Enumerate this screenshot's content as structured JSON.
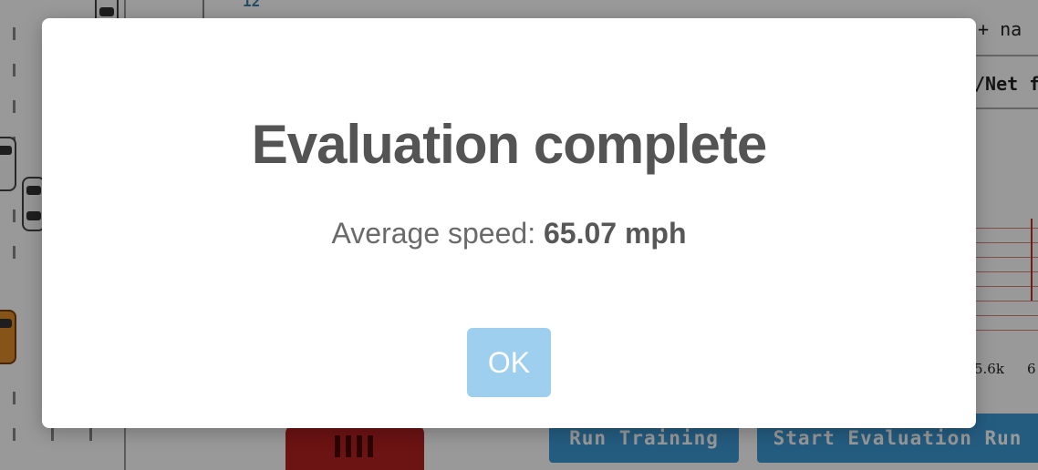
{
  "background": {
    "top_number": "12",
    "code_snippet": "+ na",
    "net_label": "/Net f",
    "chart_ticks": [
      "5.6k",
      "6"
    ],
    "buttons": {
      "run_training": "Run Training",
      "start_evaluation": "Start Evaluation Run"
    }
  },
  "modal": {
    "title": "Evaluation complete",
    "speed_label": "Average speed:",
    "speed_value": "65.07 mph",
    "ok_label": "OK"
  },
  "colors": {
    "button_blue": "#3d99d6",
    "ok_button": "#9ecfef",
    "title_text": "#545454"
  }
}
